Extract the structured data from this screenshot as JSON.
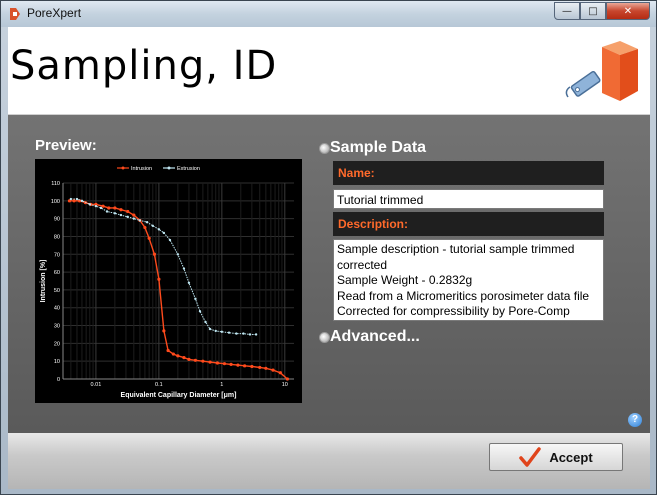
{
  "window": {
    "title": "PoreXpert",
    "buttons": {
      "minimize": "—",
      "maximize": "□",
      "close": "✕"
    }
  },
  "header": {
    "title": "Sampling, ID"
  },
  "preview": {
    "label": "Preview:"
  },
  "sample_data": {
    "label": "Sample Data",
    "name_label": "Name:",
    "name_value": "Tutorial trimmed",
    "description_label": "Description:",
    "description_value": "Sample description - tutorial sample trimmed corrected\nSample Weight - 0.2832g\nRead from a Micromeritics porosimeter data file\nCorrected for compressibility by Pore-Comp"
  },
  "advanced": {
    "label": "Advanced..."
  },
  "footer": {
    "accept_label": "Accept"
  },
  "help": {
    "glyph": "?"
  },
  "colors": {
    "intrusion": "#ff4a1c",
    "extrusion": "#bfe7f2",
    "accent": "#ff6a2b"
  },
  "chart_data": {
    "type": "line",
    "xlabel": "Equivalent Capillary Diameter [μm]",
    "ylabel": "Intrusion [%]",
    "xscale": "log",
    "xlim": [
      0.003,
      14
    ],
    "ylim": [
      0,
      110
    ],
    "xticks": [
      "0.01",
      "0.1",
      "1",
      "10"
    ],
    "yticks": [
      "0",
      "10",
      "20",
      "30",
      "40",
      "50",
      "60",
      "70",
      "80",
      "90",
      "100",
      "110"
    ],
    "legend_position": "top",
    "grid": true,
    "series": [
      {
        "name": "Intrusion",
        "x": [
          0.0038,
          0.0045,
          0.0055,
          0.0068,
          0.0083,
          0.01,
          0.013,
          0.016,
          0.02,
          0.025,
          0.032,
          0.04,
          0.05,
          0.06,
          0.07,
          0.085,
          0.1,
          0.12,
          0.14,
          0.17,
          0.2,
          0.25,
          0.3,
          0.38,
          0.5,
          0.65,
          0.85,
          1.1,
          1.4,
          1.8,
          2.3,
          3,
          4,
          5,
          6.5,
          8.5,
          11
        ],
        "y": [
          100,
          100,
          100,
          99,
          98,
          98,
          97,
          96,
          96,
          95,
          94,
          92,
          89,
          85,
          79,
          70,
          56,
          27,
          16,
          14,
          13,
          12,
          11,
          10.5,
          10,
          9.5,
          9,
          8.6,
          8.2,
          7.8,
          7.4,
          7,
          6.5,
          6,
          5,
          3.5,
          0
        ]
      },
      {
        "name": "Extrusion",
        "x": [
          0.004,
          0.005,
          0.006,
          0.008,
          0.01,
          0.012,
          0.015,
          0.02,
          0.025,
          0.032,
          0.04,
          0.05,
          0.065,
          0.08,
          0.1,
          0.12,
          0.15,
          0.2,
          0.25,
          0.3,
          0.38,
          0.45,
          0.55,
          0.65,
          0.8,
          1,
          1.3,
          1.7,
          2.2,
          2.8,
          3.5
        ],
        "y": [
          101,
          101,
          100,
          98,
          97,
          96,
          94,
          93,
          92,
          91,
          90,
          89,
          88,
          86,
          84,
          82,
          78,
          70,
          62,
          54,
          45,
          38,
          32,
          28,
          27,
          26.5,
          26,
          25.5,
          25.5,
          25,
          25
        ]
      }
    ]
  }
}
